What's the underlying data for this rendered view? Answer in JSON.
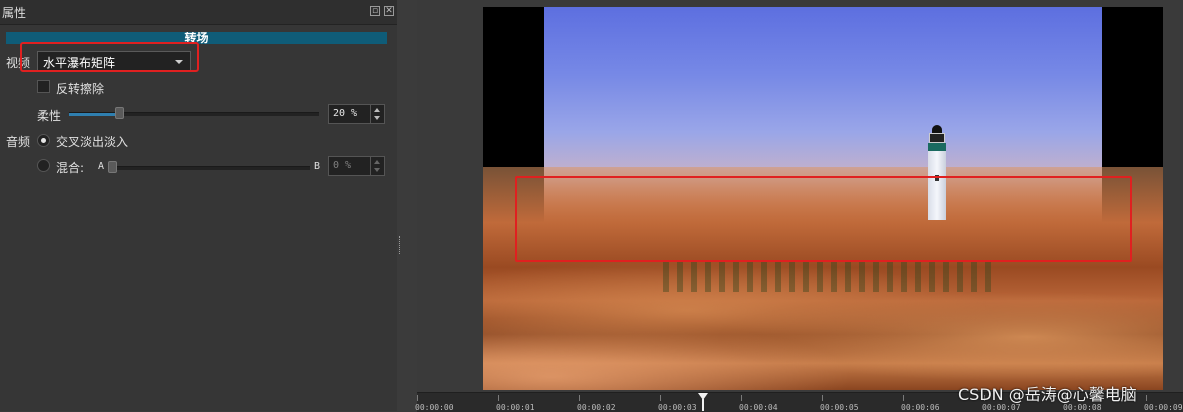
{
  "panel": {
    "title": "属性",
    "section": "转场"
  },
  "video": {
    "label": "视频",
    "effect": "水平瀑布矩阵",
    "reverse_label": "反转擦除",
    "softness_label": "柔性",
    "softness_percent": 20,
    "softness_display": "20 %"
  },
  "audio": {
    "label": "音频",
    "crossfade_label": "交叉淡出淡入",
    "mix_label": "混合:",
    "mix_a": "A",
    "mix_b": "B",
    "mix_percent": 0,
    "mix_display": "0 %"
  },
  "timeline": {
    "ticks": [
      "00:00:00",
      "00:00:01",
      "00:00:02",
      "00:00:03",
      "00:00:04",
      "00:00:05",
      "00:00:06",
      "00:00:07",
      "00:00:08",
      "00:00:09"
    ]
  },
  "watermark": "CSDN @岳涛@心馨电脑",
  "colors": {
    "section_bar": "#0f5c78",
    "highlight": "#e02020",
    "slider_fill": "#2f7fb0"
  }
}
